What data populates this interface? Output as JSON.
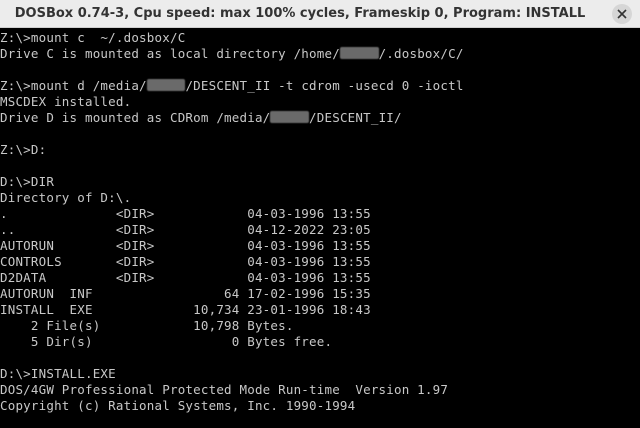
{
  "window": {
    "title": "DOSBox 0.74-3, Cpu speed: max 100% cycles, Frameskip  0, Program:  INSTALL"
  },
  "console": {
    "lines": [
      {
        "segments": [
          {
            "text": "Z:\\>mount c  ~/.dosbox/C"
          }
        ]
      },
      {
        "segments": [
          {
            "text": "Drive C is mounted as local directory /home/"
          },
          {
            "mask": "xxxxx"
          },
          {
            "text": "/.dosbox/C/"
          }
        ]
      },
      {
        "segments": [
          {
            "text": ""
          }
        ]
      },
      {
        "segments": [
          {
            "text": "Z:\\>mount d /media/"
          },
          {
            "mask": "xxxxx"
          },
          {
            "text": "/DESCENT_II -t cdrom -usecd 0 -ioctl"
          }
        ]
      },
      {
        "segments": [
          {
            "text": "MSCDEX installed."
          }
        ]
      },
      {
        "segments": [
          {
            "text": "Drive D is mounted as CDRom /media/"
          },
          {
            "mask": "xxxxx"
          },
          {
            "text": "/DESCENT_II/"
          }
        ]
      },
      {
        "segments": [
          {
            "text": ""
          }
        ]
      },
      {
        "segments": [
          {
            "text": "Z:\\>D:"
          }
        ]
      },
      {
        "segments": [
          {
            "text": ""
          }
        ]
      },
      {
        "segments": [
          {
            "text": "D:\\>DIR"
          }
        ]
      },
      {
        "segments": [
          {
            "text": "Directory of D:\\."
          }
        ]
      },
      {
        "segments": [
          {
            "text": ".              <DIR>            04-03-1996 13:55"
          }
        ]
      },
      {
        "segments": [
          {
            "text": "..             <DIR>            04-12-2022 23:05"
          }
        ]
      },
      {
        "segments": [
          {
            "text": "AUTORUN        <DIR>            04-03-1996 13:55"
          }
        ]
      },
      {
        "segments": [
          {
            "text": "CONTROLS       <DIR>            04-03-1996 13:55"
          }
        ]
      },
      {
        "segments": [
          {
            "text": "D2DATA         <DIR>            04-03-1996 13:55"
          }
        ]
      },
      {
        "segments": [
          {
            "text": "AUTORUN  INF                 64 17-02-1996 15:35"
          }
        ]
      },
      {
        "segments": [
          {
            "text": "INSTALL  EXE             10,734 23-01-1996 18:43"
          }
        ]
      },
      {
        "segments": [
          {
            "text": "    2 File(s)            10,798 Bytes."
          }
        ]
      },
      {
        "segments": [
          {
            "text": "    5 Dir(s)                  0 Bytes free."
          }
        ]
      },
      {
        "segments": [
          {
            "text": ""
          }
        ]
      },
      {
        "segments": [
          {
            "text": "D:\\>INSTALL.EXE"
          }
        ]
      },
      {
        "segments": [
          {
            "text": "DOS/4GW Professional Protected Mode Run-time  Version 1.97"
          }
        ]
      },
      {
        "segments": [
          {
            "text": "Copyright (c) Rational Systems, Inc. 1990-1994"
          }
        ]
      }
    ]
  },
  "icons": {
    "close": "close-icon"
  },
  "colors": {
    "titlebar_bg": "#ececec",
    "console_bg": "#000000",
    "console_fg": "#c8c8c8",
    "redaction": "#6a6a6a"
  }
}
